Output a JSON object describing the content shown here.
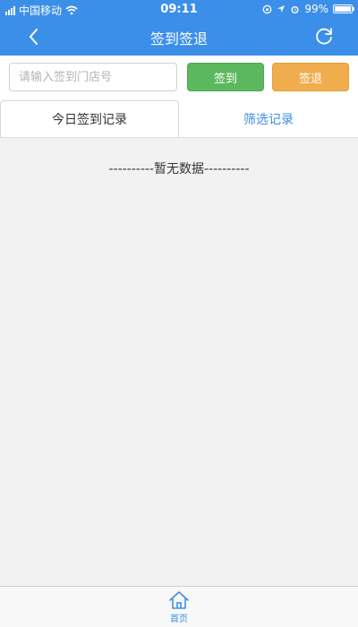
{
  "status_bar": {
    "carrier": "中国移动",
    "time": "09:11",
    "battery": "99%",
    "battery_level": 0.99
  },
  "nav": {
    "title": "签到签退",
    "back_icon": "chevron-left-icon",
    "refresh_icon": "refresh-icon"
  },
  "toolbar": {
    "store_placeholder": "请输入签到门店号",
    "store_value": "",
    "signin_label": "签到",
    "signout_label": "签退"
  },
  "tabs": {
    "today_label": "今日签到记录",
    "filter_label": "筛选记录"
  },
  "content": {
    "empty_text": "----------暂无数据----------"
  },
  "tabbar": {
    "home_label": "首页",
    "home_icon": "home-icon"
  },
  "colors": {
    "primary": "#3b8fe8",
    "signin": "#5cb85c",
    "signout": "#f0ad4e"
  }
}
